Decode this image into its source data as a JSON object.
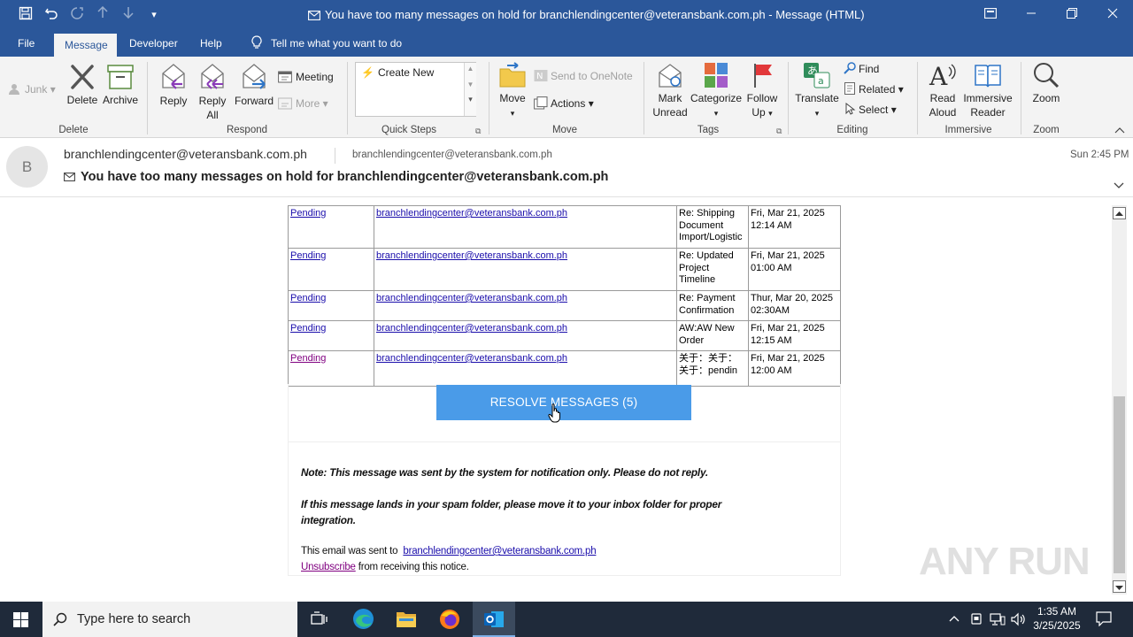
{
  "window": {
    "title": "You have too many messages on hold for branchlendingcenter@veteransbank.com.ph  -  Message (HTML)",
    "controls": [
      "restore-ribbon",
      "minimize",
      "maximize",
      "close"
    ]
  },
  "tabs": [
    "File",
    "Message",
    "Developer",
    "Help",
    "Tell me what you want to do"
  ],
  "active_tab": "Message",
  "ribbon": {
    "groups": {
      "delete": "Delete",
      "respond": "Respond",
      "quick_steps": "Quick Steps",
      "move": "Move",
      "tags": "Tags",
      "editing": "Editing",
      "immersive": "Immersive",
      "zoom": "Zoom"
    },
    "junk": "Junk",
    "delete": "Delete",
    "archive": "Archive",
    "reply": "Reply",
    "reply_all_1": "Reply",
    "reply_all_2": "All",
    "forward": "Forward",
    "meeting": "Meeting",
    "more": "More",
    "create_new": "Create New",
    "move": "Move",
    "send_onenote": "Send to OneNote",
    "actions": "Actions",
    "mark_unread_1": "Mark",
    "mark_unread_2": "Unread",
    "categorize": "Categorize",
    "follow_up_1": "Follow",
    "follow_up_2": "Up",
    "translate": "Translate",
    "find": "Find",
    "related": "Related",
    "select": "Select",
    "read_aloud_1": "Read",
    "read_aloud_2": "Aloud",
    "immersive_reader_1": "Immersive",
    "immersive_reader_2": "Reader",
    "zoom": "Zoom"
  },
  "header": {
    "avatar_letter": "B",
    "from": "branchlendingcenter@veteransbank.com.ph",
    "to": "branchlendingcenter@veteransbank.com.ph",
    "time": "Sun 2:45 PM",
    "subject": "You have too many messages on hold for branchlendingcenter@veteransbank.com.ph"
  },
  "messages": [
    {
      "status": "Pending",
      "sender": "branchlendingcenter@veteransbank.com.ph",
      "subject": [
        "Re: Shipping",
        "Document",
        "Import/Logistic"
      ],
      "date": [
        "Fri, Mar 21, 2025",
        "12:14 AM"
      ]
    },
    {
      "status": "Pending",
      "sender": "branchlendingcenter@veteransbank.com.ph",
      "subject": [
        "Re: Updated",
        "Project",
        "Timeline"
      ],
      "date": [
        "Fri, Mar 21, 2025",
        "01:00 AM"
      ]
    },
    {
      "status": "Pending",
      "sender": "branchlendingcenter@veteransbank.com.ph",
      "subject": [
        "Re: Payment",
        "Confirmation"
      ],
      "date": [
        "Thur, Mar 20, 2025",
        "02:30AM"
      ]
    },
    {
      "status": "Pending",
      "sender": "branchlendingcenter@veteransbank.com.ph",
      "subject": [
        "AW:AW New",
        "Order"
      ],
      "date": [
        "Fri, Mar 21, 2025",
        "12:15 AM"
      ]
    },
    {
      "status": "Pending",
      "sender": "branchlendingcenter@veteransbank.com.ph",
      "subject": [
        "关于：关于：",
        "关于：pendin"
      ],
      "date": [
        "Fri, Mar 21, 2025",
        "12:00 AM"
      ]
    }
  ],
  "resolve_button": "RESOLVE MESSAGES (5)",
  "notes": {
    "line1": "Note: This message was sent by the system for notification only. Please do not reply.",
    "line2a": "If this message lands in your spam folder, please move it to your inbox folder for proper",
    "line2b": "integration.",
    "sent_to_prefix": "This email was sent to",
    "sent_to_email": "branchlendingcenter@veteransbank.com.ph",
    "unsubscribe": "Unsubscribe",
    "unsubscribe_suffix": "from receiving this notice."
  },
  "watermark": "ANY RUN",
  "taskbar": {
    "search_placeholder": "Type here to search",
    "time": "1:35 AM",
    "date": "3/25/2025"
  },
  "colors": {
    "titlebar": "#2b579a",
    "resolve_button": "#4a9be8",
    "link": "#1a0dab",
    "visited_link": "#800080",
    "taskbar": "#1f2a3a"
  }
}
